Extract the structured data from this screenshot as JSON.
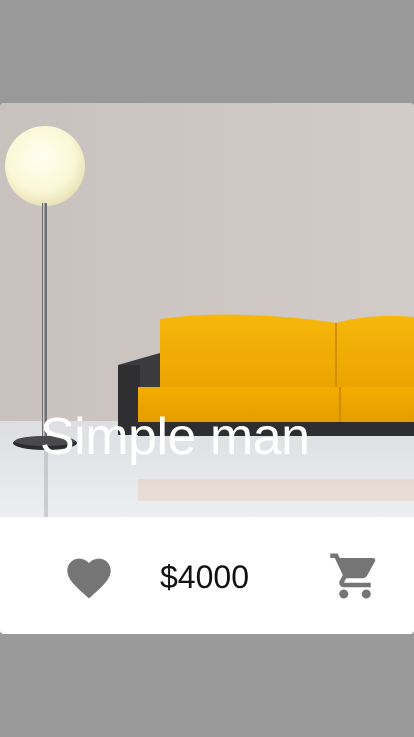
{
  "product": {
    "title": "Simple man",
    "price": "$4000",
    "image_icon": "photo-living-room-yellow-sofa"
  },
  "actions": {
    "like_icon": "heart-icon",
    "cart_icon": "shopping-cart-icon",
    "icon_color": "#757575"
  },
  "colors": {
    "background": "#999999",
    "card": "#ffffff",
    "title_text": "#ffffff",
    "price_text": "#111111"
  }
}
